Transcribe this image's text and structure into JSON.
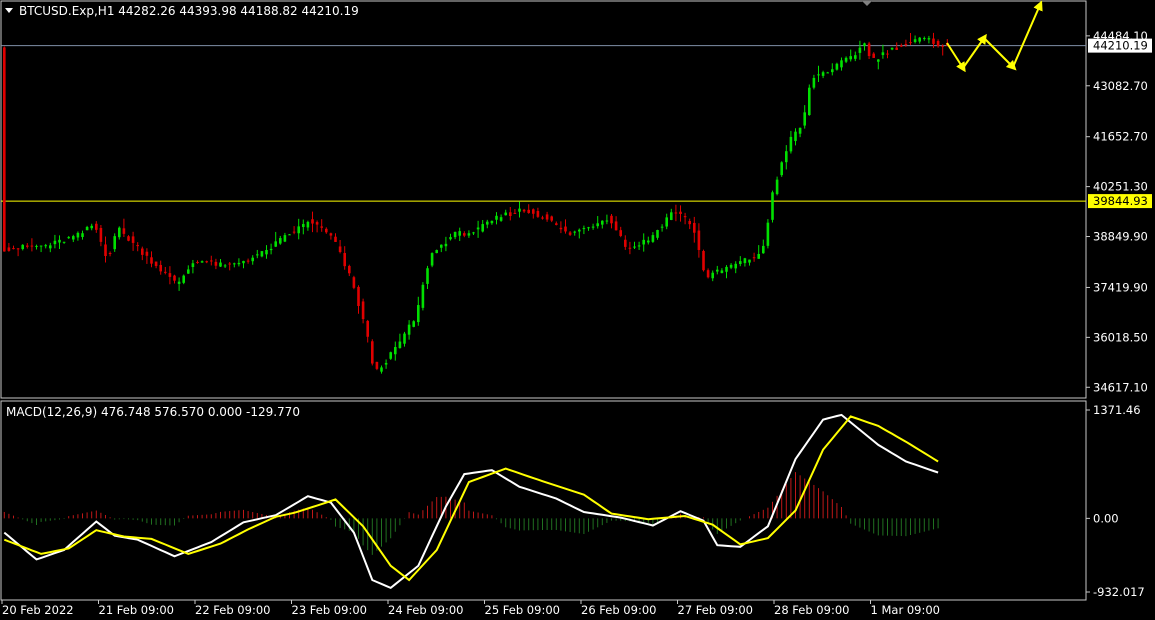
{
  "colors": {
    "background": "#000000",
    "frame": "#c8c8c8",
    "bull": "#00e000",
    "bear": "#e00000",
    "support_line": "#ffff00",
    "price_line": "#8090a8",
    "forecast": "#ffff00",
    "macd_line": "#ffffff",
    "signal_line": "#ffff00",
    "hist_pos": "#c01818",
    "hist_neg": "#207020"
  },
  "header": {
    "menu_icon": "triangle-down-icon",
    "text": "BTCUSD.Exp,H1  44282.26 44393.98 44188.82 44210.19"
  },
  "price_axis": {
    "labels": [
      "44484.10",
      "43082.70",
      "41652.70",
      "40251.30",
      "38849.90",
      "37419.90",
      "36018.50",
      "34617.10"
    ],
    "ylim": [
      34344.0,
      45435.0
    ],
    "current_price": "44210.19",
    "support_level": "39844.93"
  },
  "macd_panel": {
    "label": "MACD(12,26,9) 476.748 576.570 0.000 -129.770",
    "axis_labels": [
      "1371.46",
      "0.00",
      "-932.017"
    ],
    "ylim": [
      -932.017,
      1371.46
    ]
  },
  "time_axis": {
    "labels": [
      "20 Feb 2022",
      "21 Feb 09:00",
      "22 Feb 09:00",
      "23 Feb 09:00",
      "24 Feb 09:00",
      "25 Feb 09:00",
      "26 Feb 09:00",
      "27 Feb 09:00",
      "28 Feb 09:00",
      "1 Mar 09:00"
    ]
  },
  "chart_data": {
    "type": "candlestick",
    "symbol": "BTCUSD.Exp",
    "timeframe": "H1",
    "last_bar": {
      "open": 44282.26,
      "high": 44393.98,
      "low": 44188.82,
      "close": 44210.19
    },
    "price_path": [
      [
        0,
        38500
      ],
      [
        10,
        38600
      ],
      [
        17,
        38900
      ],
      [
        20,
        39200
      ],
      [
        23,
        38200
      ],
      [
        25,
        39100
      ],
      [
        33,
        38100
      ],
      [
        38,
        37500
      ],
      [
        42,
        38200
      ],
      [
        49,
        38000
      ],
      [
        57,
        38400
      ],
      [
        60,
        38700
      ],
      [
        67,
        39300
      ],
      [
        72,
        38800
      ],
      [
        76,
        37600
      ],
      [
        79,
        36300
      ],
      [
        81,
        35000
      ],
      [
        85,
        35600
      ],
      [
        90,
        36600
      ],
      [
        93,
        38300
      ],
      [
        98,
        38900
      ],
      [
        103,
        39000
      ],
      [
        108,
        39400
      ],
      [
        113,
        39600
      ],
      [
        118,
        39400
      ],
      [
        123,
        38900
      ],
      [
        127,
        39100
      ],
      [
        132,
        39400
      ],
      [
        136,
        38500
      ],
      [
        141,
        38800
      ],
      [
        146,
        39600
      ],
      [
        150,
        39200
      ],
      [
        153,
        37700
      ],
      [
        158,
        38000
      ],
      [
        164,
        38300
      ],
      [
        166,
        38600
      ],
      [
        167,
        39900
      ],
      [
        171,
        41500
      ],
      [
        174,
        42000
      ],
      [
        176,
        43300
      ],
      [
        181,
        43600
      ],
      [
        186,
        44000
      ],
      [
        187,
        44400
      ],
      [
        189,
        43800
      ],
      [
        195,
        44200
      ],
      [
        200,
        44400
      ],
      [
        205,
        44210
      ]
    ],
    "macd_path": [
      [
        0,
        -180
      ],
      [
        7,
        -520
      ],
      [
        13,
        -400
      ],
      [
        20,
        -40
      ],
      [
        24,
        -220
      ],
      [
        29,
        -270
      ],
      [
        37,
        -480
      ],
      [
        45,
        -300
      ],
      [
        52,
        -50
      ],
      [
        59,
        40
      ],
      [
        66,
        280
      ],
      [
        71,
        200
      ],
      [
        76,
        -180
      ],
      [
        80,
        -780
      ],
      [
        84,
        -880
      ],
      [
        90,
        -600
      ],
      [
        96,
        150
      ],
      [
        100,
        560
      ],
      [
        106,
        610
      ],
      [
        112,
        400
      ],
      [
        120,
        250
      ],
      [
        126,
        80
      ],
      [
        134,
        10
      ],
      [
        141,
        -90
      ],
      [
        147,
        90
      ],
      [
        152,
        -30
      ],
      [
        155,
        -340
      ],
      [
        160,
        -360
      ],
      [
        166,
        -100
      ],
      [
        172,
        750
      ],
      [
        178,
        1250
      ],
      [
        182,
        1310
      ],
      [
        186,
        1120
      ],
      [
        190,
        930
      ],
      [
        196,
        720
      ],
      [
        203,
        580
      ]
    ],
    "signal_path": [
      [
        0,
        -270
      ],
      [
        8,
        -450
      ],
      [
        14,
        -380
      ],
      [
        20,
        -150
      ],
      [
        26,
        -230
      ],
      [
        32,
        -260
      ],
      [
        40,
        -450
      ],
      [
        47,
        -320
      ],
      [
        53,
        -140
      ],
      [
        59,
        20
      ],
      [
        63,
        70
      ],
      [
        69,
        180
      ],
      [
        72,
        240
      ],
      [
        78,
        -100
      ],
      [
        84,
        -600
      ],
      [
        88,
        -780
      ],
      [
        94,
        -400
      ],
      [
        101,
        460
      ],
      [
        109,
        630
      ],
      [
        117,
        470
      ],
      [
        126,
        300
      ],
      [
        132,
        60
      ],
      [
        140,
        -10
      ],
      [
        148,
        30
      ],
      [
        154,
        -80
      ],
      [
        160,
        -330
      ],
      [
        166,
        -250
      ],
      [
        172,
        100
      ],
      [
        178,
        870
      ],
      [
        184,
        1290
      ],
      [
        190,
        1170
      ],
      [
        196,
        970
      ],
      [
        203,
        720
      ]
    ],
    "forecast_points": [
      [
        947,
        43
      ],
      [
        963,
        68
      ],
      [
        984,
        38
      ],
      [
        1013,
        67
      ],
      [
        1040,
        5
      ]
    ]
  }
}
